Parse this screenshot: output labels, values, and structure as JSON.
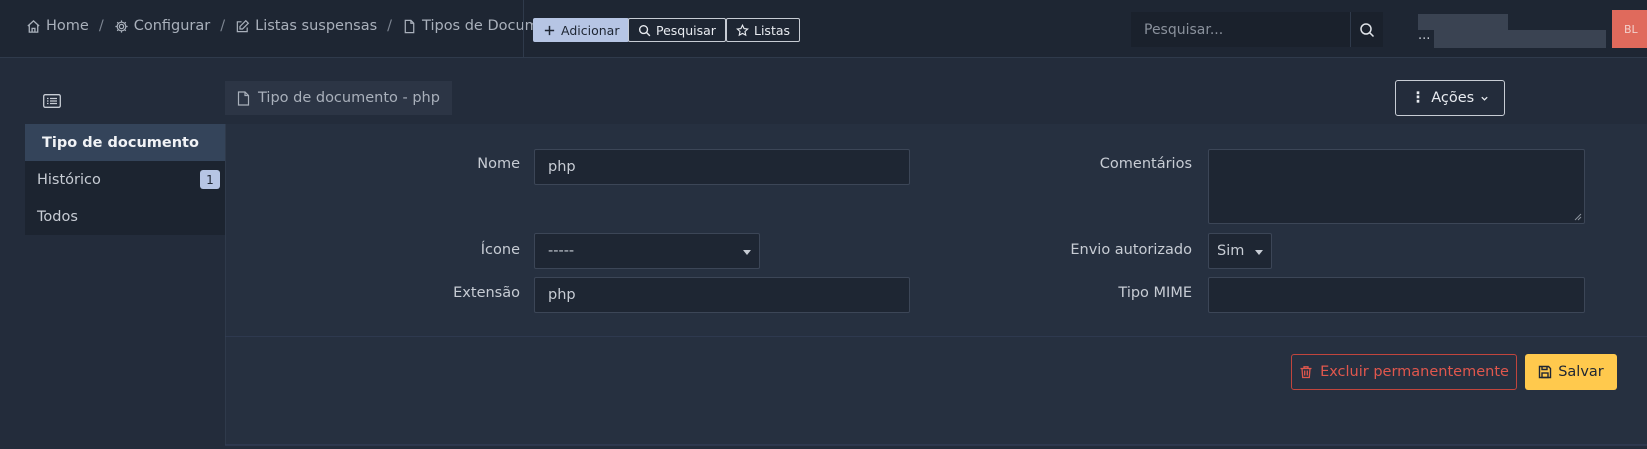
{
  "breadcrumb": {
    "home": "Home",
    "configurar": "Configurar",
    "listas": "Listas suspensas",
    "current": "Tipos de Docum..."
  },
  "toolbar": {
    "adicionar": "Adicionar",
    "pesquisar": "Pesquisar",
    "listas": "Listas"
  },
  "search": {
    "placeholder": "Pesquisar..."
  },
  "user": {
    "dots": "...",
    "initials": "BL"
  },
  "sidebar": {
    "items": [
      {
        "label": "Tipo de documento",
        "active": true
      },
      {
        "label": "Histórico",
        "badge": "1"
      },
      {
        "label": "Todos"
      }
    ]
  },
  "record": {
    "tab_title": "Tipo de documento - php",
    "actions_label": "Ações"
  },
  "form": {
    "nome": {
      "label": "Nome",
      "value": "php"
    },
    "icone": {
      "label": "Ícone",
      "value": "-----"
    },
    "extensao": {
      "label": "Extensão",
      "value": "php"
    },
    "comentarios": {
      "label": "Comentários",
      "value": ""
    },
    "envio": {
      "label": "Envio autorizado",
      "value": "Sim"
    },
    "mime": {
      "label": "Tipo MIME",
      "value": ""
    }
  },
  "buttons": {
    "delete": "Excluir permanentemente",
    "save": "Salvar"
  },
  "colors": {
    "accent_blue": "#b6c5e4",
    "danger": "#e0574d",
    "save": "#ffc94d",
    "avatar": "#e06a5c"
  }
}
